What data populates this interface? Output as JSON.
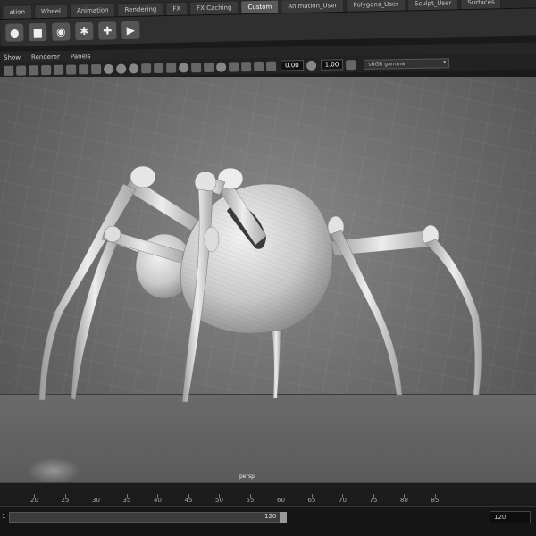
{
  "shelf_tabs": [
    {
      "label": "ation",
      "active": false
    },
    {
      "label": "Wheel",
      "active": false
    },
    {
      "label": "Animation",
      "active": false
    },
    {
      "label": "Rendering",
      "active": false
    },
    {
      "label": "FX",
      "active": false
    },
    {
      "label": "FX Caching",
      "active": false
    },
    {
      "label": "Custom",
      "active": true
    },
    {
      "label": "Animation_User",
      "active": false
    },
    {
      "label": "Polygons_User",
      "active": false
    },
    {
      "label": "Sculpt_User",
      "active": false
    },
    {
      "label": "Surfaces",
      "active": false
    }
  ],
  "panel_menu": [
    "Show",
    "Renderer",
    "Panels"
  ],
  "toolbar": {
    "value_a": "0.00",
    "value_b": "1.00",
    "color_space": "sRGB gamma"
  },
  "viewport": {
    "camera": "persp"
  },
  "time_slider": {
    "ticks": [
      "20",
      "25",
      "30",
      "35",
      "40",
      "45",
      "50",
      "55",
      "60",
      "65",
      "70",
      "75",
      "80",
      "85"
    ]
  },
  "range": {
    "start": "1",
    "end_marker": "120",
    "end_field": "120"
  }
}
